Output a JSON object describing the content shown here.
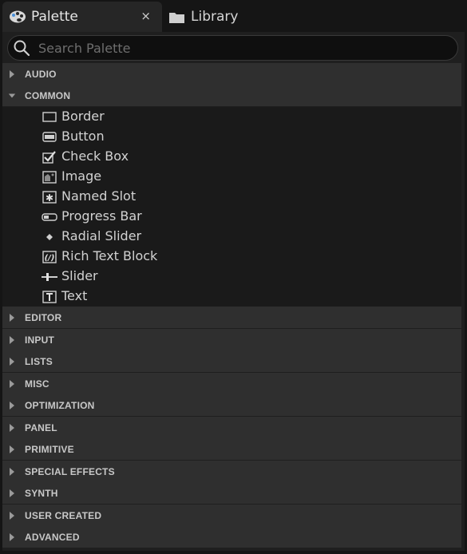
{
  "tabs": {
    "palette": {
      "label": "Palette",
      "close": "×"
    },
    "library": {
      "label": "Library"
    }
  },
  "search": {
    "placeholder": "Search Palette"
  },
  "categories": [
    {
      "label": "AUDIO",
      "expanded": false
    },
    {
      "label": "COMMON",
      "expanded": true
    },
    {
      "label": "EDITOR",
      "expanded": false
    },
    {
      "label": "INPUT",
      "expanded": false
    },
    {
      "label": "LISTS",
      "expanded": false
    },
    {
      "label": "MISC",
      "expanded": false
    },
    {
      "label": "OPTIMIZATION",
      "expanded": false
    },
    {
      "label": "PANEL",
      "expanded": false
    },
    {
      "label": "PRIMITIVE",
      "expanded": false
    },
    {
      "label": "SPECIAL EFFECTS",
      "expanded": false
    },
    {
      "label": "SYNTH",
      "expanded": false
    },
    {
      "label": "USER CREATED",
      "expanded": false
    },
    {
      "label": "ADVANCED",
      "expanded": false
    }
  ],
  "common_items": [
    {
      "label": "Border",
      "icon": "border-icon"
    },
    {
      "label": "Button",
      "icon": "button-icon"
    },
    {
      "label": "Check Box",
      "icon": "checkbox-icon"
    },
    {
      "label": "Image",
      "icon": "image-icon"
    },
    {
      "label": "Named Slot",
      "icon": "named-slot-icon"
    },
    {
      "label": "Progress Bar",
      "icon": "progress-bar-icon"
    },
    {
      "label": "Radial Slider",
      "icon": "radial-slider-icon"
    },
    {
      "label": "Rich Text Block",
      "icon": "rich-text-icon"
    },
    {
      "label": "Slider",
      "icon": "slider-icon"
    },
    {
      "label": "Text",
      "icon": "text-icon"
    }
  ],
  "colors": {
    "background": "#151515",
    "panel": "#1f1f1f",
    "category_row": "#2f2f2f",
    "text": "#c8c8c8"
  }
}
